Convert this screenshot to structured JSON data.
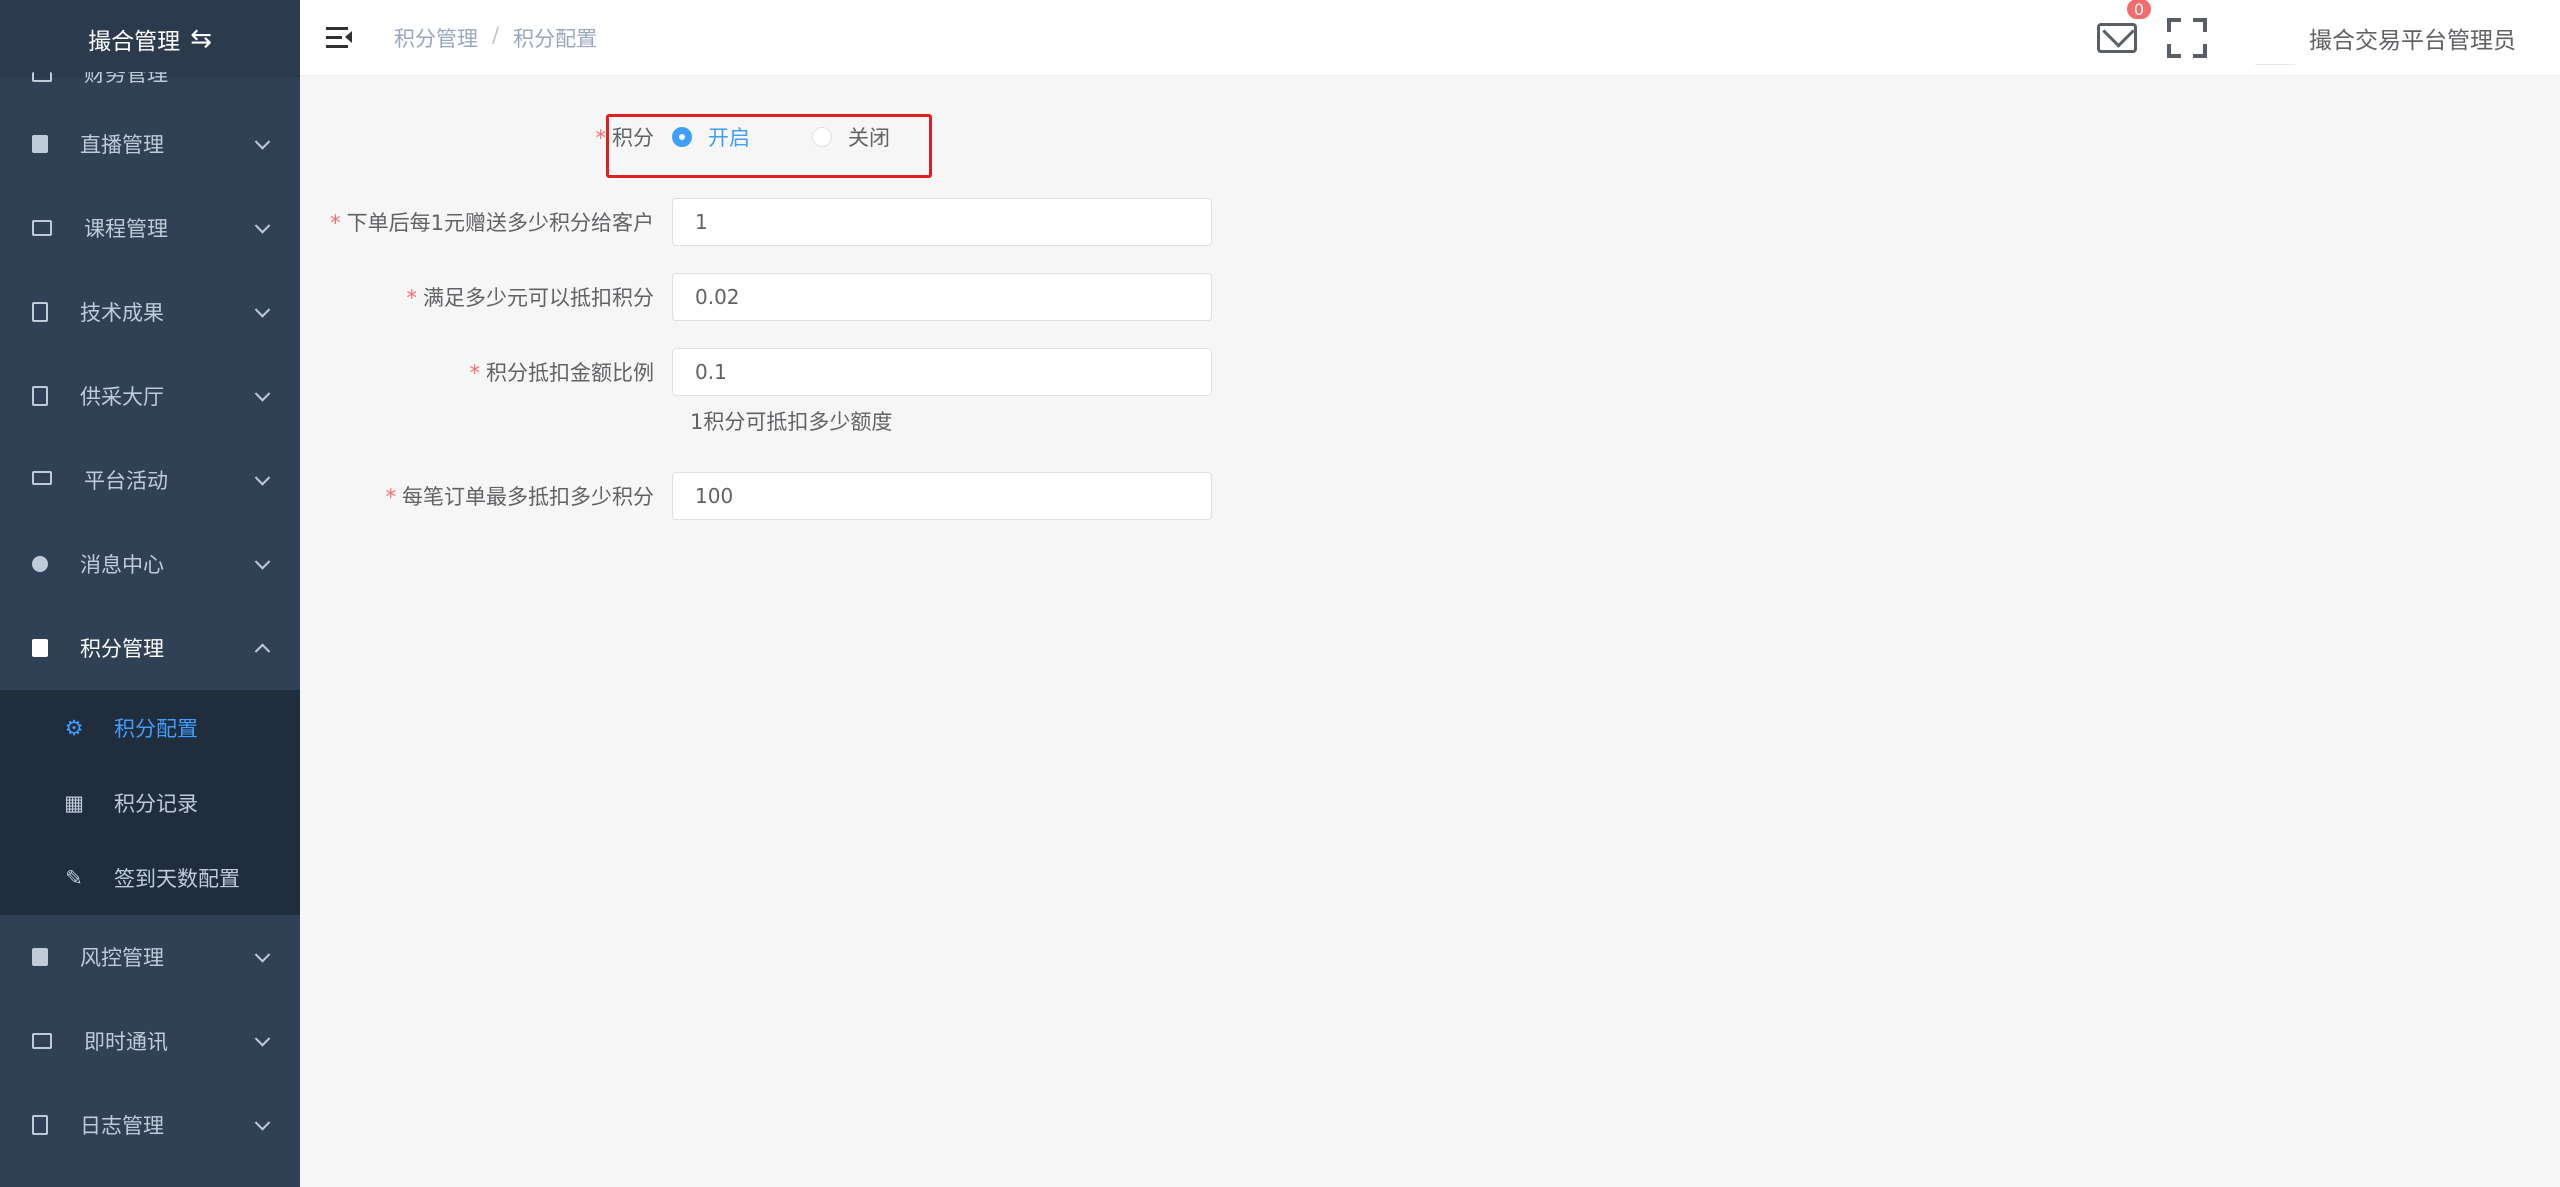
{
  "sidebar": {
    "logo_text": "撮合管理",
    "partial_item": "财务管理",
    "items": [
      {
        "label": "直播管理"
      },
      {
        "label": "课程管理"
      },
      {
        "label": "技术成果"
      },
      {
        "label": "供采大厅"
      },
      {
        "label": "平台活动"
      },
      {
        "label": "消息中心"
      },
      {
        "label": "积分管理"
      }
    ],
    "submenu": [
      {
        "label": "积分配置"
      },
      {
        "label": "积分记录"
      },
      {
        "label": "签到天数配置"
      }
    ],
    "items_after": [
      {
        "label": "风控管理"
      },
      {
        "label": "即时通讯"
      },
      {
        "label": "日志管理"
      }
    ]
  },
  "header": {
    "breadcrumb": [
      "积分管理",
      "积分配置"
    ],
    "badge_count": "0",
    "username": "撮合交易平台管理员"
  },
  "form": {
    "points_label": "积分",
    "radio_on": "开启",
    "radio_off": "关闭",
    "selected": "开启",
    "field1_label": "下单后每1元赠送多少积分给客户",
    "field1_value": "1",
    "field2_label": "满足多少元可以抵扣积分",
    "field2_value": "0.02",
    "field3_label": "积分抵扣金额比例",
    "field3_value": "0.1",
    "field3_hint": "1积分可抵扣多少额度",
    "field4_label": "每笔订单最多抵扣多少积分",
    "field4_value": "100"
  },
  "colors": {
    "sidebar_bg": "#304156",
    "submenu_bg": "#1f2d3d",
    "accent": "#409eff",
    "required": "#f56c6c",
    "highlight": "#e02020"
  }
}
